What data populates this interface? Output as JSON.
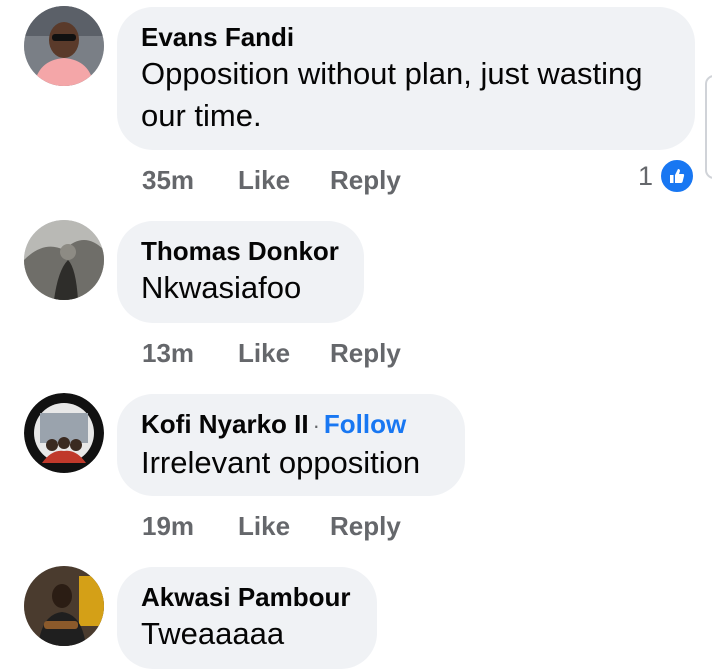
{
  "comments": [
    {
      "author": "Evans Fandi",
      "text_line1": "Opposition without plan, just wasting",
      "text_line2": "our time.",
      "time": "35m",
      "like": "Like",
      "reply": "Reply",
      "reaction_count": "1",
      "reaction_icon": "thumbs-up-icon"
    },
    {
      "author": "Thomas Donkor",
      "text": "Nkwasiafoo",
      "time": "13m",
      "like": "Like",
      "reply": "Reply"
    },
    {
      "author": "Kofi Nyarko II",
      "separator": "·",
      "follow": "Follow",
      "text": "Irrelevant opposition",
      "time": "19m",
      "like": "Like",
      "reply": "Reply"
    },
    {
      "author": "Akwasi Pambour",
      "text": "Tweaaaaa"
    }
  ],
  "colors": {
    "bubble": "#f0f2f5",
    "meta_text": "#65676b",
    "link_blue": "#1877f2"
  }
}
